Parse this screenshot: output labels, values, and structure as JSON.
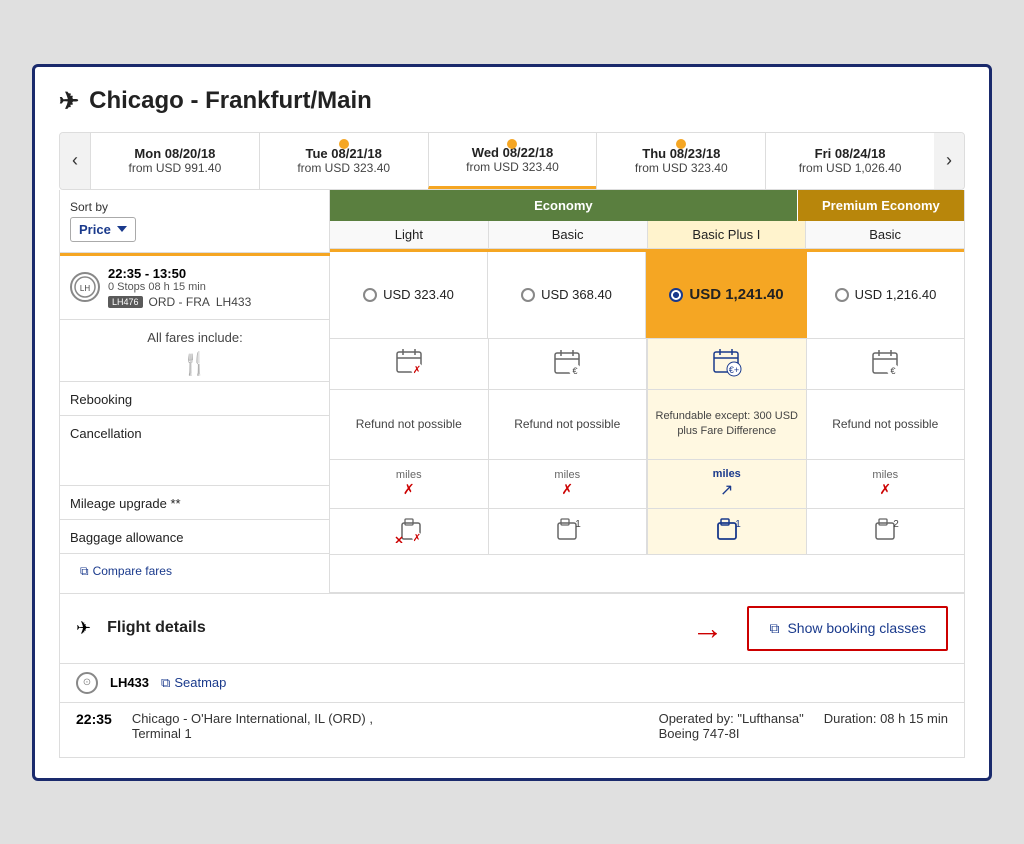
{
  "title": "Chicago - Frankfurt/Main",
  "dateTabs": [
    {
      "label": "Mon 08/20/18",
      "price": "from USD 991.40",
      "active": false,
      "dot": false
    },
    {
      "label": "Tue 08/21/18",
      "price": "from USD 323.40",
      "active": false,
      "dot": true
    },
    {
      "label": "Wed 08/22/18",
      "price": "from USD 323.40",
      "active": true,
      "dot": true
    },
    {
      "label": "Thu 08/23/18",
      "price": "from USD 323.40",
      "active": false,
      "dot": true
    },
    {
      "label": "Fri 08/24/18",
      "price": "from USD 1,026.40",
      "active": false,
      "dot": false
    }
  ],
  "sort": {
    "label": "Sort by",
    "value": "Price"
  },
  "fareHeaders": {
    "economy": "Economy",
    "premium": "Premium Economy"
  },
  "fareSubHeaders": [
    "Light",
    "Basic",
    "Basic Plus I",
    "Basic"
  ],
  "flight": {
    "time": "22:35 - 13:50",
    "stops": "0 Stops 08 h 15 min",
    "route": "ORD - FRA",
    "flightCode": "LH433",
    "prices": [
      {
        "value": "USD 323.40",
        "highlighted": false,
        "selected": false
      },
      {
        "value": "USD 368.40",
        "highlighted": false,
        "selected": false
      },
      {
        "value": "USD 1,241.40",
        "highlighted": true,
        "selected": true
      },
      {
        "value": "USD 1,216.40",
        "highlighted": false,
        "selected": false
      }
    ]
  },
  "allFares": {
    "label": "All fares include:",
    "compareLink": "Compare fares"
  },
  "features": {
    "rebooking": {
      "label": "Rebooking",
      "cells": [
        "calendar-x",
        "calendar-euro",
        "calendar-plus-euro",
        "calendar-euro"
      ]
    },
    "cancellation": {
      "label": "Cancellation",
      "cells": [
        "Refund not possible",
        "Refund not possible",
        "Refundable except: 300 USD plus Fare Difference",
        "Refund not possible"
      ]
    },
    "mileage": {
      "label": "Mileage upgrade **",
      "cells": [
        "miles ✗",
        "miles ✗",
        "miles ↗",
        "miles ✗"
      ]
    },
    "baggage": {
      "label": "Baggage allowance",
      "cells": [
        "suitcase-x",
        "suitcase-1",
        "suitcase-1-blue",
        "suitcase-2"
      ]
    }
  },
  "flightDetails": {
    "title": "Flight details",
    "showBookingLabel": "Show booking classes",
    "arrowLabel": "→"
  },
  "flightDetail": {
    "code": "LH433",
    "seatmapLabel": "Seatmap",
    "departTime": "22:35",
    "departInfo": "Chicago - O'Hare International, IL (ORD) ,\nTerminal 1",
    "operatedBy": "Operated by: \"Lufthansa\"\nBoeing 747-8I",
    "duration": "Duration: 08 h 15 min"
  }
}
